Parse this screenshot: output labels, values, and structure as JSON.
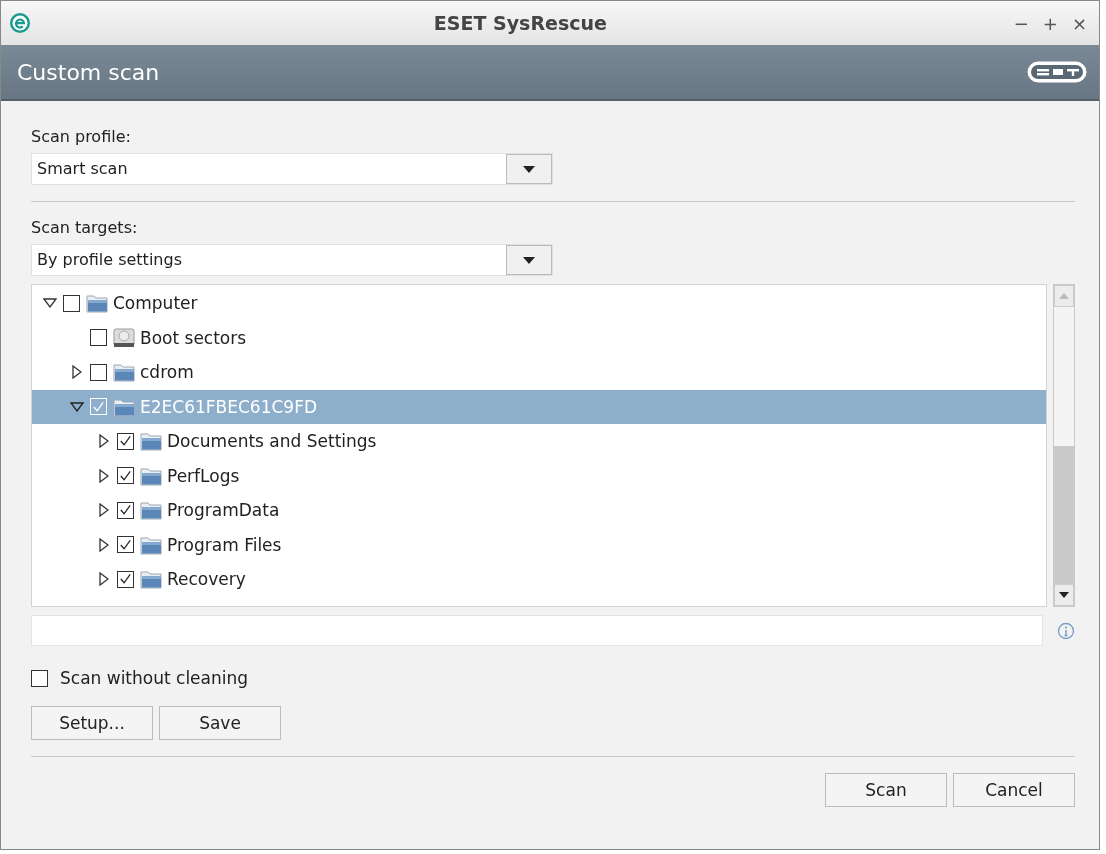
{
  "window": {
    "title": "ESET SysRescue",
    "controls": [
      "−",
      "+",
      "×"
    ]
  },
  "header": {
    "title": "Custom scan"
  },
  "scan_profile": {
    "label": "Scan profile:",
    "value": "Smart scan"
  },
  "scan_targets": {
    "label": "Scan targets:",
    "value": "By profile settings"
  },
  "tree": [
    {
      "label": "Computer",
      "kind": "folder",
      "expanded": true,
      "checked": false,
      "selected": false,
      "children": [
        {
          "label": "Boot sectors",
          "kind": "drive",
          "checked": false,
          "selected": false
        },
        {
          "label": "cdrom",
          "kind": "folder",
          "expanded": false,
          "checked": false,
          "selected": false
        },
        {
          "label": "E2EC61FBEC61C9FD",
          "kind": "folder",
          "expanded": true,
          "checked": true,
          "selected": true,
          "children": [
            {
              "label": "Documents and Settings",
              "kind": "folder",
              "expanded": false,
              "checked": true,
              "selected": false
            },
            {
              "label": "PerfLogs",
              "kind": "folder",
              "expanded": false,
              "checked": true,
              "selected": false
            },
            {
              "label": "ProgramData",
              "kind": "folder",
              "expanded": false,
              "checked": true,
              "selected": false
            },
            {
              "label": "Program Files",
              "kind": "folder",
              "expanded": false,
              "checked": true,
              "selected": false
            },
            {
              "label": "Recovery",
              "kind": "folder",
              "expanded": false,
              "checked": true,
              "selected": false
            }
          ]
        }
      ]
    }
  ],
  "scan_without_cleaning": {
    "label": "Scan without cleaning",
    "checked": false
  },
  "buttons_left": [
    "Setup...",
    "Save"
  ],
  "buttons_right": [
    "Scan",
    "Cancel"
  ]
}
